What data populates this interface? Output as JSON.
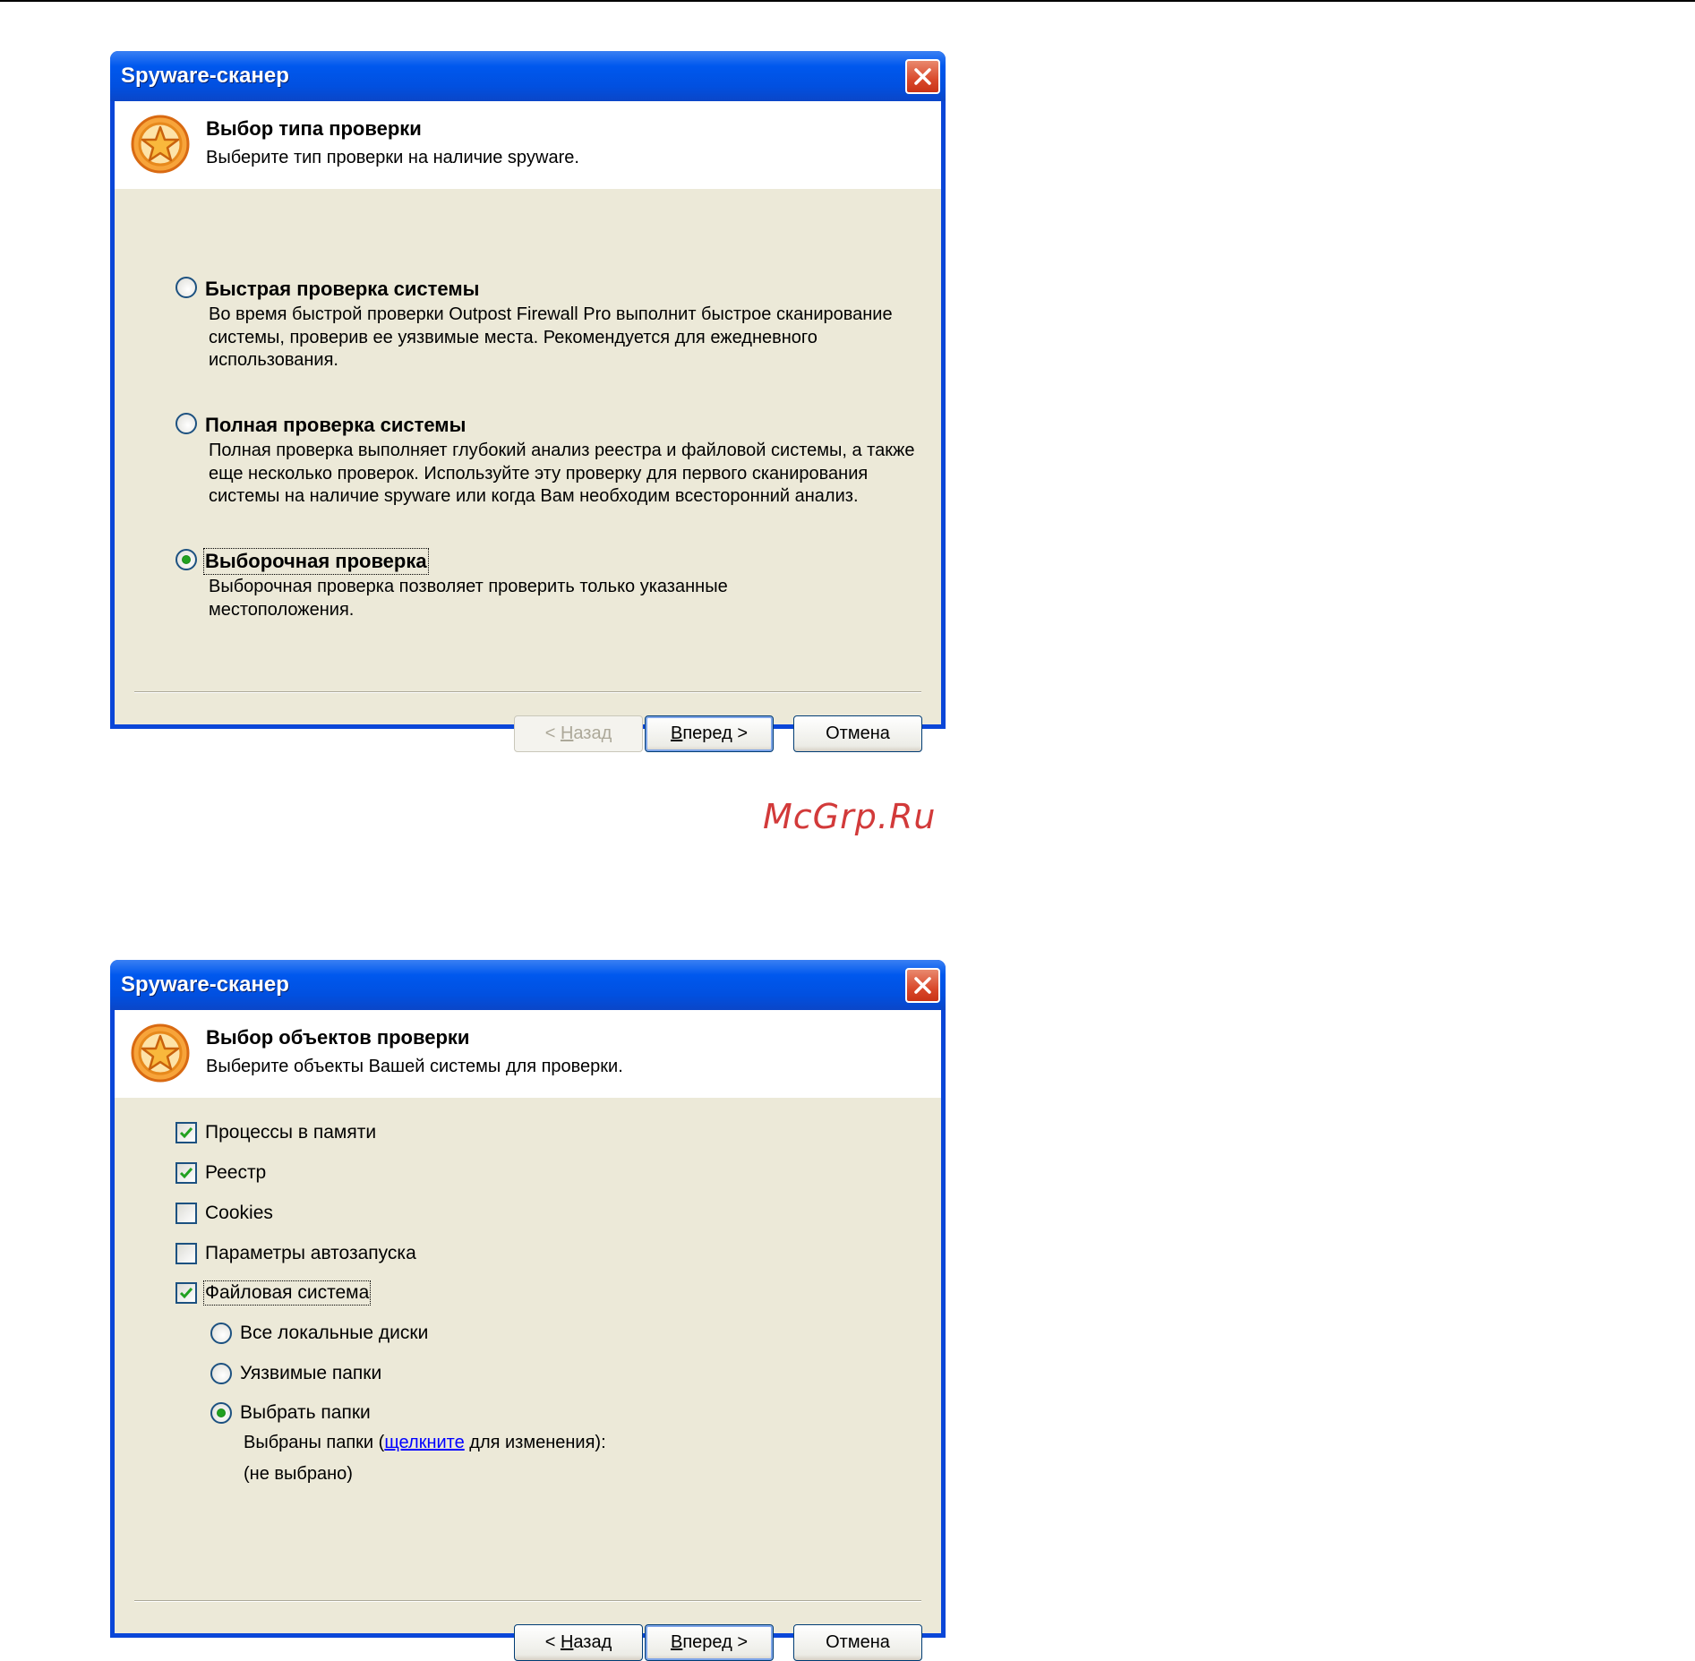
{
  "watermark": "McGrp.Ru",
  "dialog1": {
    "title": "Spyware-сканер",
    "header_title": "Выбор типа проверки",
    "header_subtitle": "Выберите тип проверки на наличие spyware.",
    "options": [
      {
        "title": "Быстрая проверка системы",
        "desc": "Во время быстрой проверки Outpost Firewall Pro выполнит быстрое сканирование системы, проверив ее уязвимые места. Рекомендуется для ежедневного использования.",
        "selected": false
      },
      {
        "title": "Полная проверка системы",
        "desc": "Полная проверка выполняет глубокий анализ реестра и файловой системы, а также еще несколько проверок. Используйте эту проверку для первого сканирования системы на наличие spyware или когда Вам необходим всесторонний анализ.",
        "selected": false
      },
      {
        "title": "Выборочная проверка",
        "desc": "Выборочная проверка позволяет проверить только указанные местоположения.",
        "selected": true
      }
    ],
    "buttons": {
      "back_prefix": "< ",
      "back_u": "Н",
      "back_rest": "азад",
      "back_enabled": false,
      "next_u": "В",
      "next_rest": "перед >",
      "cancel": "Отмена"
    }
  },
  "dialog2": {
    "title": "Spyware-сканер",
    "header_title": "Выбор объектов проверки",
    "header_subtitle": "Выберите объекты Вашей системы для проверки.",
    "checkboxes": [
      {
        "label": "Процессы в памяти",
        "checked": true
      },
      {
        "label": "Реестр",
        "checked": true
      },
      {
        "label": "Cookies",
        "checked": false
      },
      {
        "label": "Параметры автозапуска",
        "checked": false
      },
      {
        "label": "Файловая система",
        "checked": true
      }
    ],
    "radios": [
      {
        "label": "Все локальные диски",
        "selected": false
      },
      {
        "label": "Уязвимые папки",
        "selected": false
      },
      {
        "label": "Выбрать папки",
        "selected": true
      }
    ],
    "selected_folders_prefix": "Выбраны папки (",
    "selected_folders_link": "щелкните",
    "selected_folders_suffix": " для изменения):",
    "selected_folders_value": "(не выбрано)",
    "buttons": {
      "back_prefix": "< ",
      "back_u": "Н",
      "back_rest": "азад",
      "back_enabled": true,
      "next_u": "В",
      "next_rest": "перед >",
      "cancel": "Отмена"
    }
  }
}
